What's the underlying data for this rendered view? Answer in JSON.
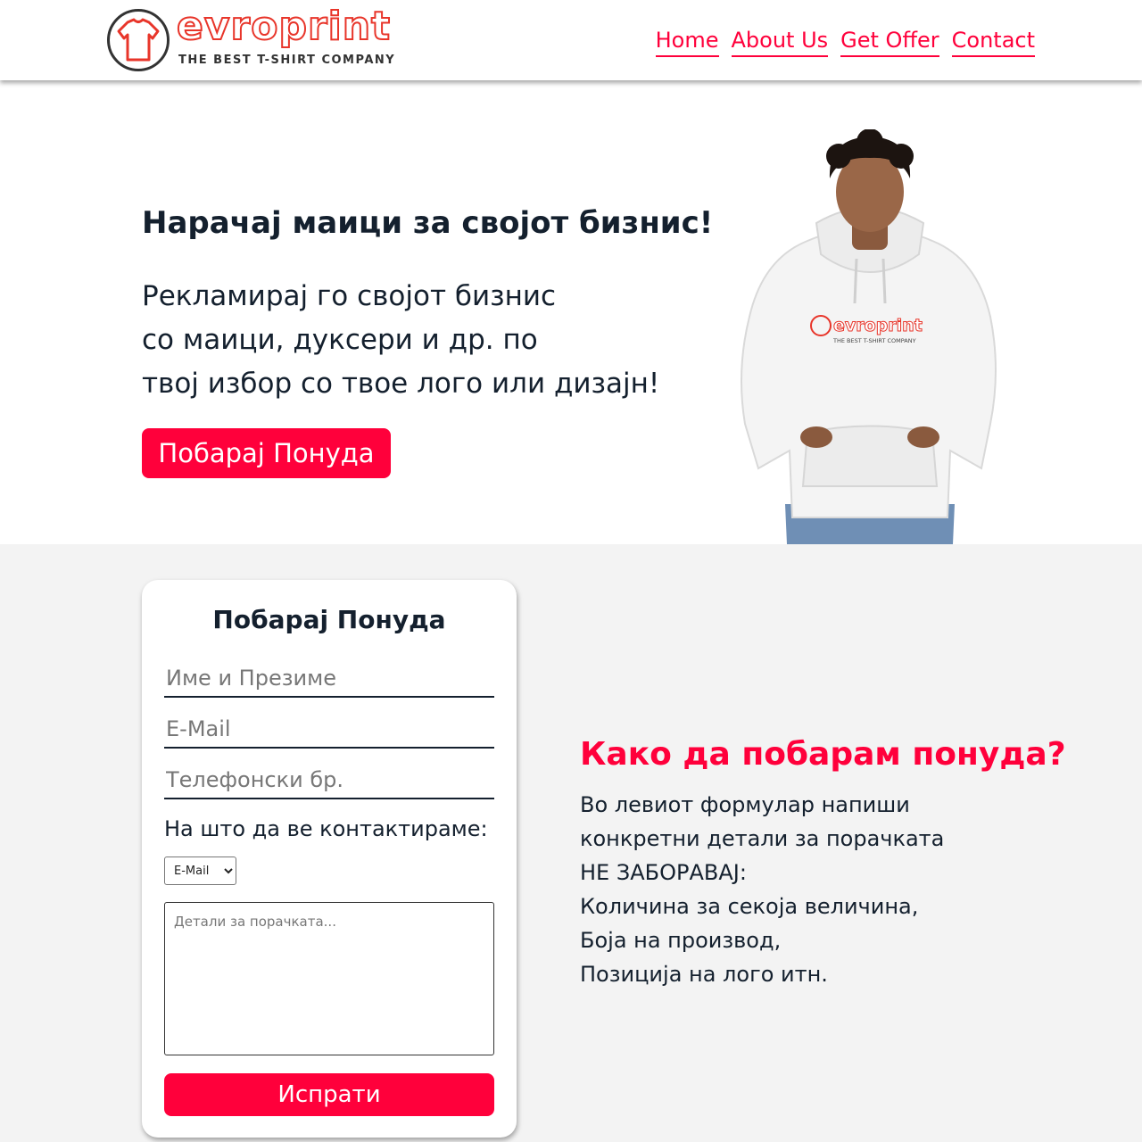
{
  "brand": {
    "name": "evroprint",
    "tagline": "THE BEST T-SHIRT COMPANY",
    "accent_color": "#ff003b",
    "logo_color": "#e8352a"
  },
  "nav": {
    "items": [
      {
        "label": "Home"
      },
      {
        "label": "About Us"
      },
      {
        "label": "Get Offer"
      },
      {
        "label": "Contact"
      }
    ]
  },
  "hero": {
    "title": "Нарачај маици за својот бизнис!",
    "lines": [
      "Рекламирај го својот бизнис",
      "со маици, дуксери и др. по",
      "твој избор со твое лого или дизајн!"
    ],
    "button_label": "Побарај Понуда",
    "hoodie_print": "evroprint",
    "hoodie_print_tag": "THE BEST T-SHIRT COMPANY"
  },
  "form": {
    "title": "Побарај Понуда",
    "name_placeholder": "Име и Презиме",
    "email_placeholder": "E-Mail",
    "phone_placeholder": "Телефонски бр.",
    "contact_label": "На што да ве контактираме:",
    "contact_selected": "E-Mail",
    "details_placeholder": "Детали за порачката...",
    "submit_label": "Испрати"
  },
  "info": {
    "title": "Како да побарам понуда?",
    "lines": [
      "Во левиот формулар напиши",
      "конкретни детали за порачката",
      "НЕ ЗАБОРАВАЈ:",
      "Количина за секоја величина,",
      "Боја на производ,",
      "Позиција на лого итн."
    ]
  }
}
